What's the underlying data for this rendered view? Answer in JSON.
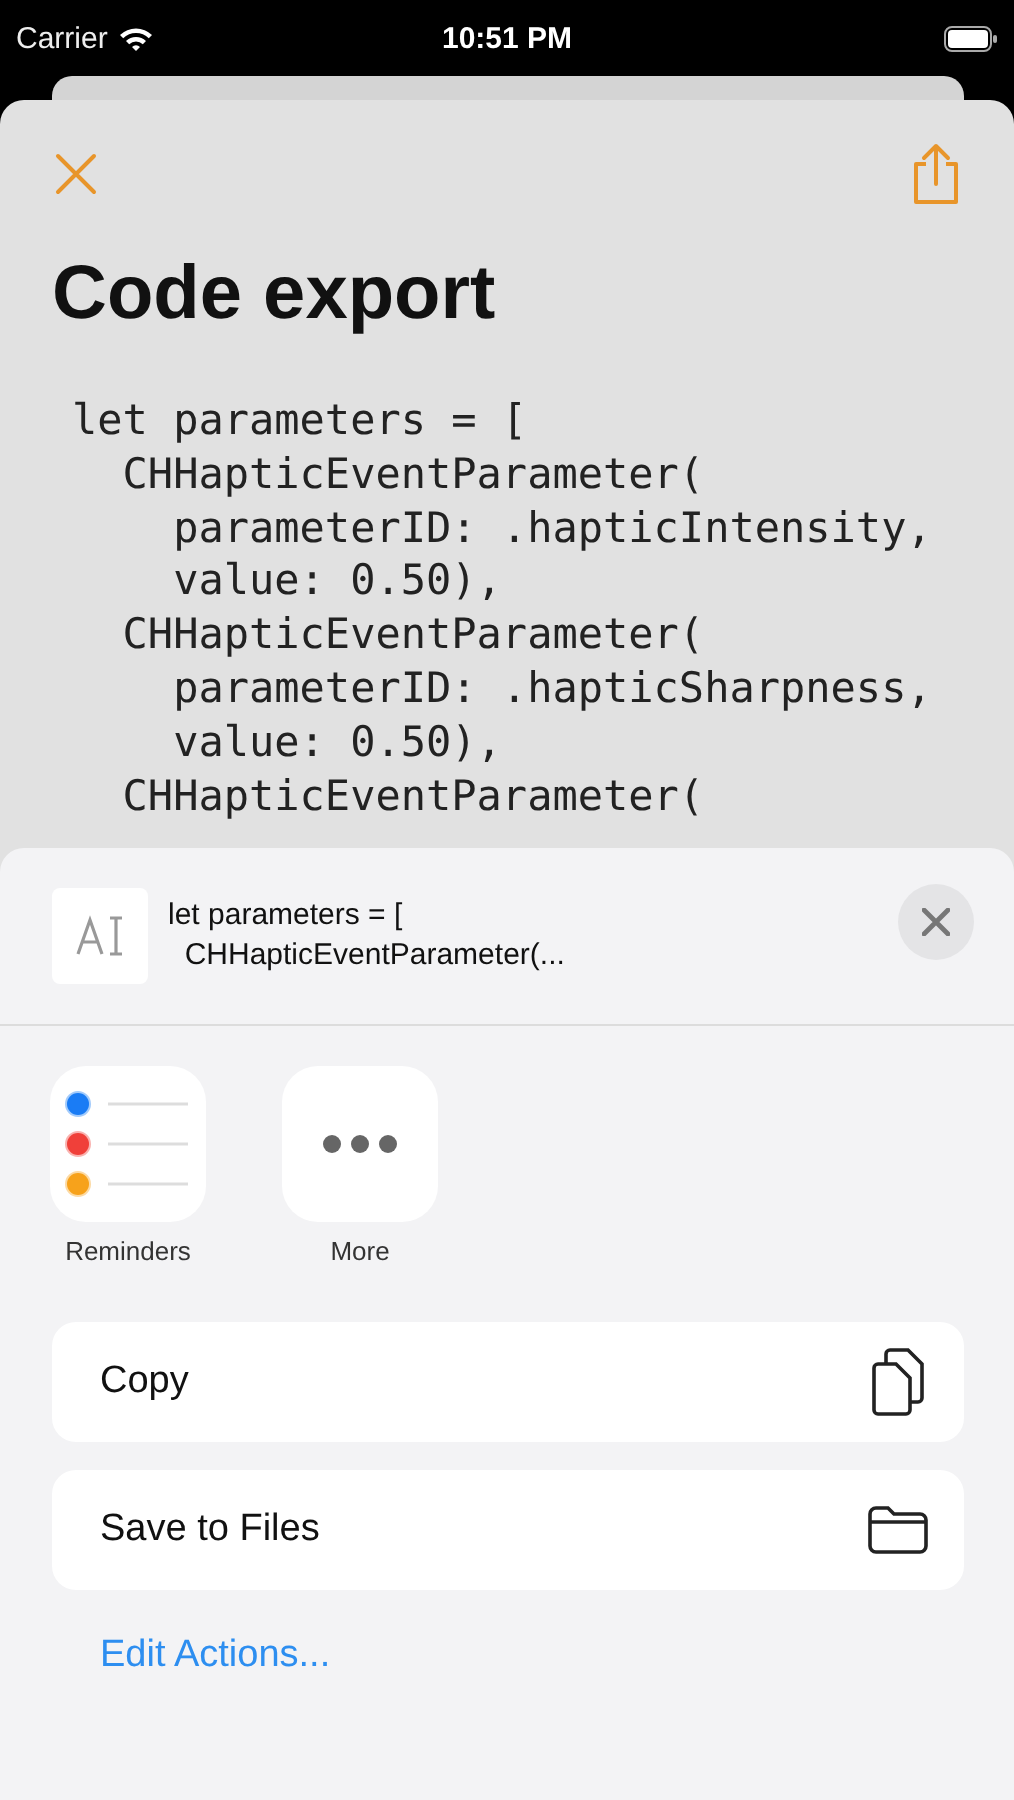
{
  "status_bar": {
    "carrier": "Carrier",
    "time": "10:51 PM"
  },
  "screen": {
    "title": "Code export",
    "code_lines": [
      "let parameters = [",
      "  CHHapticEventParameter(",
      "    parameterID: .hapticIntensity,",
      "    value: 0.50),",
      "  CHHapticEventParameter(",
      "    parameterID: .hapticSharpness,",
      "    value: 0.50),",
      "  CHHapticEventParameter("
    ]
  },
  "share_sheet": {
    "preview_lines": [
      "let parameters = [",
      "  CHHapticEventParameter(..."
    ],
    "apps": [
      {
        "kind": "reminders",
        "label": "Reminders"
      },
      {
        "kind": "more",
        "label": "More"
      }
    ],
    "actions": [
      {
        "kind": "copy",
        "label": "Copy"
      },
      {
        "kind": "files",
        "label": "Save to Files"
      }
    ],
    "edit_link": "Edit Actions..."
  }
}
